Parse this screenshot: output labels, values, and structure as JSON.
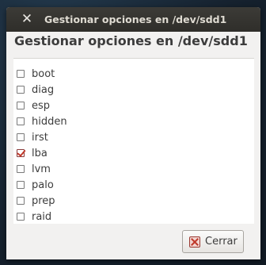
{
  "window": {
    "title": "Gestionar opciones en /dev/sdd1",
    "close_glyph": "✕"
  },
  "header": "Gestionar opciones en /dev/sdd1",
  "options": [
    {
      "label": "boot",
      "checked": false
    },
    {
      "label": "diag",
      "checked": false
    },
    {
      "label": "esp",
      "checked": false
    },
    {
      "label": "hidden",
      "checked": false
    },
    {
      "label": "irst",
      "checked": false
    },
    {
      "label": "lba",
      "checked": true
    },
    {
      "label": "lvm",
      "checked": false
    },
    {
      "label": "palo",
      "checked": false
    },
    {
      "label": "prep",
      "checked": false
    },
    {
      "label": "raid",
      "checked": false
    }
  ],
  "footer": {
    "close_label": "Cerrar",
    "close_icon": "cancel-icon"
  },
  "colors": {
    "titlebar": "#3c3b37",
    "background": "#f2f1f0",
    "check_accent": "#c0392b"
  }
}
